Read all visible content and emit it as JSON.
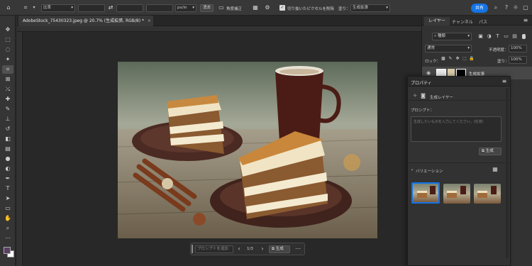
{
  "options_bar": {
    "mode_label": "比率",
    "unit_label": "px/in",
    "clear_label": "消去",
    "straighten_label": "角度補正",
    "delete_cropped_label": "切り抜いたピクセルを削除",
    "fill_label": "塗り：",
    "fill_value": "生成拡張",
    "share_label": "共有"
  },
  "document": {
    "tab_title": "AdobeStock_75430323.jpeg @ 20.7% (生成拡張, RGB/8) *"
  },
  "tools": [
    "move-icon",
    "marquee-icon",
    "lasso-icon",
    "magic-wand-icon",
    "crop-icon",
    "frame-icon",
    "eyedropper-icon",
    "healing-icon",
    "brush-icon",
    "stamp-icon",
    "history-brush-icon",
    "eraser-icon",
    "gradient-icon",
    "blur-icon",
    "dodge-icon",
    "pen-icon",
    "type-icon",
    "path-select-icon",
    "shape-icon",
    "hand-icon",
    "zoom-icon",
    "more-icon"
  ],
  "contextual_taskbar": {
    "prompt_placeholder": "プロンプトを追加",
    "page_indicator": "1/3",
    "generate_label": "生成"
  },
  "layers_panel": {
    "tabs": [
      "レイヤー",
      "チャンネル",
      "パス"
    ],
    "filter_kind": "種類",
    "blend_mode": "通常",
    "opacity_label": "不透明度：",
    "opacity_value": "100%",
    "lock_label": "ロック：",
    "fill_label": "塗り：",
    "fill_value": "100%",
    "layer_name": "生成拡張"
  },
  "properties_panel": {
    "title": "プロパティ",
    "layer_type": "生成レイヤー",
    "prompt_label": "プロンプト：",
    "prompt_placeholder": "生成したいものを入力してください。(任意)",
    "generate_label": "生成",
    "variations_label": "バリエーション"
  },
  "colors": {
    "accent": "#1473e6",
    "foreground": "#5a3e66",
    "background": "#ffffff"
  }
}
